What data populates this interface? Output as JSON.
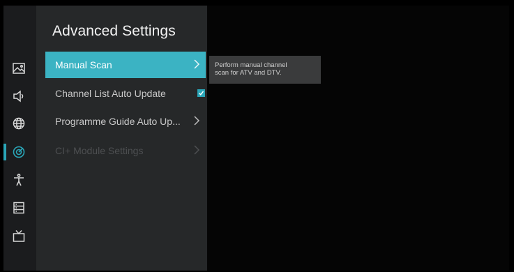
{
  "page_title": "Advanced Settings",
  "menu": {
    "items": [
      {
        "label": "Manual Scan",
        "state": "selected",
        "control": "chevron"
      },
      {
        "label": "Channel List Auto Update",
        "state": "normal",
        "control": "checkbox",
        "checked": true
      },
      {
        "label": "Programme Guide Auto Up...",
        "state": "normal",
        "control": "chevron"
      },
      {
        "label": "CI+ Module Settings",
        "state": "disabled",
        "control": "chevron"
      }
    ]
  },
  "tooltip": {
    "line1": "Perform manual channel",
    "line2": "scan for ATV and DTV."
  },
  "sidebar": {
    "icons": [
      {
        "name": "picture-icon"
      },
      {
        "name": "sound-icon"
      },
      {
        "name": "network-icon"
      },
      {
        "name": "channel-icon",
        "active": true
      },
      {
        "name": "accessibility-icon"
      },
      {
        "name": "system-icon"
      },
      {
        "name": "tv-icon"
      }
    ]
  },
  "colors": {
    "accent": "#3bb3c3",
    "panel": "#262829",
    "rail": "#1b1c1e",
    "tooltip_bg": "#3a3b3c"
  }
}
